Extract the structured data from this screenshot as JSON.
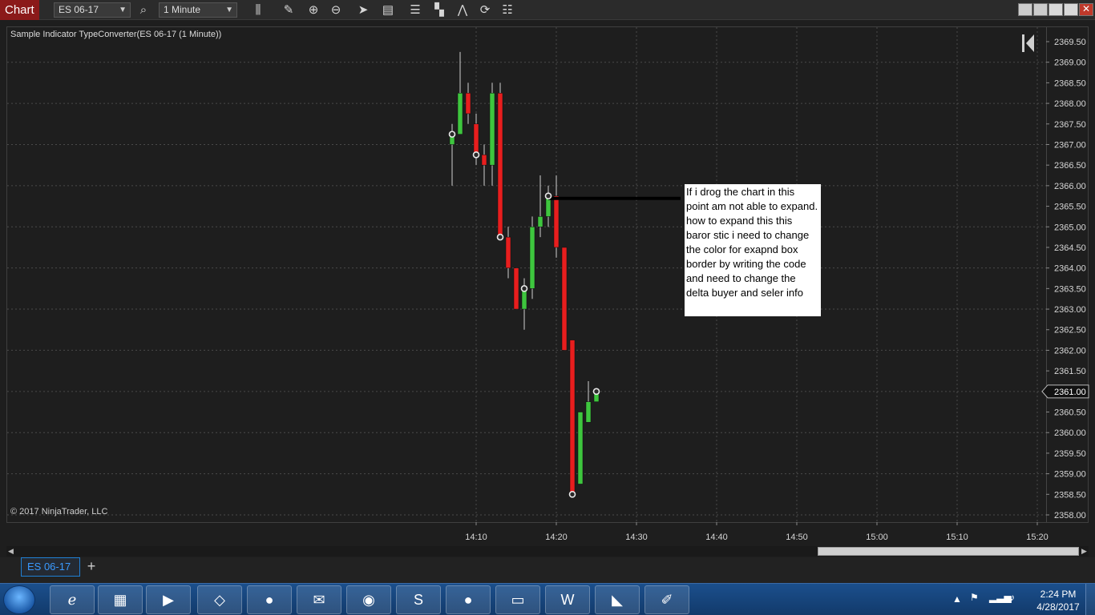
{
  "toolbar": {
    "app_tab": "Chart",
    "instrument": "ES 06-17",
    "interval": "1 Minute",
    "icons": [
      "search-icon",
      "bar-type-icon",
      "pencil-icon",
      "zoom-in-icon",
      "zoom-out-icon",
      "pointer-icon",
      "data-box-icon",
      "strategy-icon",
      "indicator-icon",
      "drawing-tools-icon",
      "refresh-icon",
      "properties-icon"
    ]
  },
  "chart": {
    "indicator_label": "Sample Indicator TypeConverter(ES 06-17 (1 Minute))",
    "copyright": "© 2017 NinjaTrader, LLC",
    "current_price_label": "2361.00"
  },
  "annotation": {
    "text": "If i drog the chart in this point am not able to expand. how to expand this this baror stic i need to change the color for exapnd box border by writing the code and need to change the delta buyer and seler info"
  },
  "chart_data": {
    "type": "candlestick",
    "title": "",
    "y_ticks": [
      "2369.50",
      "2369.00",
      "2368.50",
      "2368.00",
      "2367.50",
      "2367.00",
      "2366.50",
      "2366.00",
      "2365.50",
      "2365.00",
      "2364.50",
      "2364.00",
      "2363.50",
      "2363.00",
      "2362.50",
      "2362.00",
      "2361.50",
      "2361.00",
      "2360.50",
      "2360.00",
      "2359.50",
      "2359.00",
      "2358.50",
      "2358.00"
    ],
    "x_ticks": [
      "14:10",
      "14:20",
      "14:30",
      "14:40",
      "14:50",
      "15:00",
      "15:10",
      "15:20"
    ],
    "ylim": [
      2357.75,
      2369.75
    ],
    "x_time_range": [
      "14:10",
      "15:20"
    ],
    "current_price": 2361.0,
    "candles": [
      {
        "t": "14:07",
        "open": 2367.0,
        "high": 2367.5,
        "low": 2366.0,
        "close": 2367.25
      },
      {
        "t": "14:08",
        "open": 2367.25,
        "high": 2369.25,
        "low": 2367.25,
        "close": 2368.25
      },
      {
        "t": "14:09",
        "open": 2368.25,
        "high": 2368.5,
        "low": 2367.5,
        "close": 2367.75
      },
      {
        "t": "14:10",
        "open": 2367.5,
        "high": 2367.75,
        "low": 2366.5,
        "close": 2366.75
      },
      {
        "t": "14:11",
        "open": 2366.75,
        "high": 2367.0,
        "low": 2366.0,
        "close": 2366.5
      },
      {
        "t": "14:12",
        "open": 2366.5,
        "high": 2368.5,
        "low": 2366.0,
        "close": 2368.25
      },
      {
        "t": "14:13",
        "open": 2368.25,
        "high": 2368.5,
        "low": 2364.75,
        "close": 2364.75
      },
      {
        "t": "14:14",
        "open": 2364.75,
        "high": 2365.0,
        "low": 2363.75,
        "close": 2364.0
      },
      {
        "t": "14:15",
        "open": 2364.0,
        "high": 2364.0,
        "low": 2363.0,
        "close": 2363.0
      },
      {
        "t": "14:16",
        "open": 2363.0,
        "high": 2363.75,
        "low": 2362.5,
        "close": 2363.5
      },
      {
        "t": "14:17",
        "open": 2363.5,
        "high": 2365.25,
        "low": 2363.25,
        "close": 2365.0
      },
      {
        "t": "14:18",
        "open": 2365.0,
        "high": 2366.25,
        "low": 2364.75,
        "close": 2365.25
      },
      {
        "t": "14:19",
        "open": 2365.25,
        "high": 2366.0,
        "low": 2365.0,
        "close": 2365.75
      },
      {
        "t": "14:20",
        "open": 2365.75,
        "high": 2366.25,
        "low": 2364.25,
        "close": 2364.5
      },
      {
        "t": "14:21",
        "open": 2364.5,
        "high": 2364.5,
        "low": 2362.0,
        "close": 2362.0
      },
      {
        "t": "14:22",
        "open": 2362.25,
        "high": 2362.25,
        "low": 2358.5,
        "close": 2358.5
      },
      {
        "t": "14:23",
        "open": 2358.75,
        "high": 2360.5,
        "low": 2358.75,
        "close": 2360.5
      },
      {
        "t": "14:24",
        "open": 2360.25,
        "high": 2361.25,
        "low": 2360.25,
        "close": 2360.75
      },
      {
        "t": "14:25",
        "open": 2360.75,
        "high": 2361.0,
        "low": 2360.75,
        "close": 2361.0
      }
    ],
    "markers": [
      {
        "t": "14:07",
        "price": 2367.25
      },
      {
        "t": "14:10",
        "price": 2366.75
      },
      {
        "t": "14:13",
        "price": 2364.75
      },
      {
        "t": "14:16",
        "price": 2363.5
      },
      {
        "t": "14:19",
        "price": 2365.75
      },
      {
        "t": "14:22",
        "price": 2358.5
      },
      {
        "t": "14:25",
        "price": 2361.0
      }
    ],
    "annotation_line": {
      "t_start": "14:19",
      "t_end": "14:36",
      "price": 2365.75
    },
    "colors": {
      "up": "#3ec63e",
      "down": "#e81e1e",
      "wick": "#d0d0d0",
      "grid": "#4a4a4a",
      "background": "#1e1e1e"
    }
  },
  "bottom_tabs": {
    "active": "ES 06-17",
    "add": "+"
  },
  "taskbar": {
    "apps": [
      "internet-explorer-icon",
      "file-explorer-icon",
      "media-player-icon",
      "visual-studio-icon",
      "firefox-icon",
      "outlook-icon",
      "chrome-icon",
      "skype-icon",
      "screen-recorder-icon",
      "notepad-icon",
      "word-icon",
      "ninjatrader-icon",
      "paint-icon"
    ],
    "time": "2:24 PM",
    "date": "4/28/2017"
  }
}
